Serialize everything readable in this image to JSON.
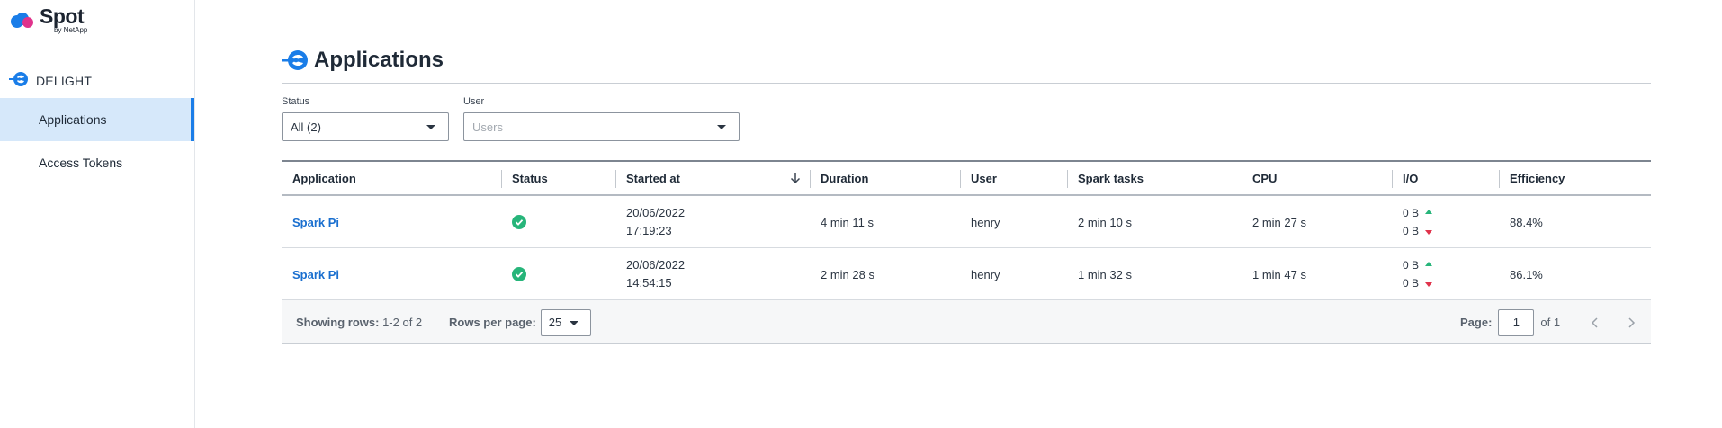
{
  "brand": {
    "name": "Spot",
    "sub": "by NetApp"
  },
  "sidebar": {
    "section": "DELIGHT",
    "items": [
      {
        "label": "Applications",
        "active": true
      },
      {
        "label": "Access Tokens",
        "active": false
      }
    ]
  },
  "main": {
    "title": "Applications",
    "filters": {
      "status": {
        "label": "Status",
        "value": "All (2)"
      },
      "user": {
        "label": "User",
        "placeholder": "Users"
      }
    },
    "table": {
      "columns": [
        "Application",
        "Status",
        "Started at",
        "Duration",
        "User",
        "Spark tasks",
        "CPU",
        "I/O",
        "Efficiency"
      ],
      "rows": [
        {
          "application": "Spark Pi",
          "status": "success",
          "date": "20/06/2022",
          "time": "17:19:23",
          "duration": "4 min 11 s",
          "user": "henry",
          "spark_tasks": "2 min 10 s",
          "cpu": "2 min 27 s",
          "io_in": "0 B",
          "io_out": "0 B",
          "efficiency": "88.4%"
        },
        {
          "application": "Spark Pi",
          "status": "success",
          "date": "20/06/2022",
          "time": "14:54:15",
          "duration": "2 min 28 s",
          "user": "henry",
          "spark_tasks": "1 min 32 s",
          "cpu": "1 min 47 s",
          "io_in": "0 B",
          "io_out": "0 B",
          "efficiency": "86.1%"
        }
      ]
    },
    "footer": {
      "showing_label": "Showing rows:",
      "showing_value": "1-2 of 2",
      "rows_per_page_label": "Rows per page:",
      "rows_per_page": "25",
      "page_label": "Page:",
      "page": "1",
      "of_pages": "of 1"
    }
  },
  "colors": {
    "accent": "#1a7de8",
    "link": "#1a6fcf",
    "success": "#27b57a",
    "down": "#e0334b",
    "active_bg": "#d6e8fa"
  },
  "icons": [
    "spot-logo-icon",
    "delight-icon",
    "sort-down-icon",
    "check-circle-icon",
    "arrow-up-icon",
    "arrow-down-icon",
    "chevron-left-icon",
    "chevron-right-icon",
    "chevron-down-icon"
  ]
}
